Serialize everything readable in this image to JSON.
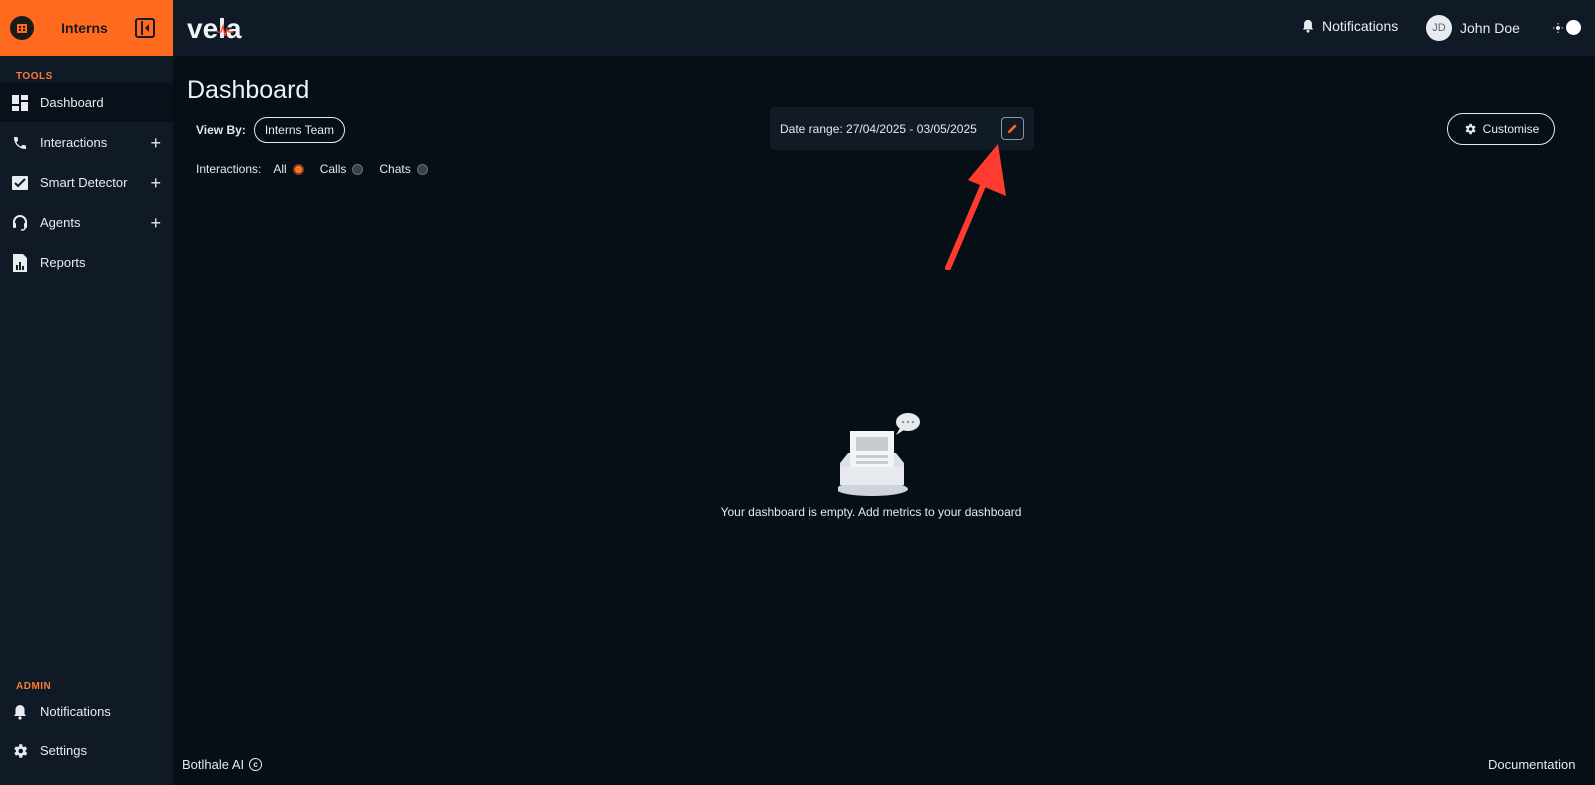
{
  "sidebar": {
    "org_name": "Interns",
    "tools_label": "TOOLS",
    "admin_label": "ADMIN",
    "items": [
      {
        "label": "Dashboard",
        "icon": "dashboard-icon",
        "active": true
      },
      {
        "label": "Interactions",
        "icon": "phone-icon",
        "expandable": true
      },
      {
        "label": "Smart Detector",
        "icon": "chart-check-icon",
        "expandable": true
      },
      {
        "label": "Agents",
        "icon": "headset-icon",
        "expandable": true
      },
      {
        "label": "Reports",
        "icon": "report-icon"
      }
    ],
    "admin_items": [
      {
        "label": "Notifications",
        "icon": "bell-icon"
      },
      {
        "label": "Settings",
        "icon": "gear-icon"
      }
    ]
  },
  "topbar": {
    "brand": "vela",
    "notifications_label": "Notifications",
    "user_initials": "JD",
    "user_name": "John Doe"
  },
  "main": {
    "title": "Dashboard",
    "view_by_label": "View By:",
    "view_by_value": "Interns Team",
    "interactions_label": "Interactions:",
    "interaction_options": [
      {
        "label": "All",
        "selected": true
      },
      {
        "label": "Calls",
        "selected": false
      },
      {
        "label": "Chats",
        "selected": false
      }
    ],
    "date_range": "Date range: 27/04/2025 - 03/05/2025",
    "customise_label": "Customise",
    "empty_message": "Your dashboard is empty. Add metrics to your dashboard"
  },
  "footer": {
    "company": "Botlhale AI",
    "copyright_symbol": "c",
    "documentation": "Documentation"
  },
  "colors": {
    "accent": "#ff6a1f",
    "background": "#060e16",
    "panel": "#0f1a26",
    "annotation_arrow": "#ff3b30"
  }
}
